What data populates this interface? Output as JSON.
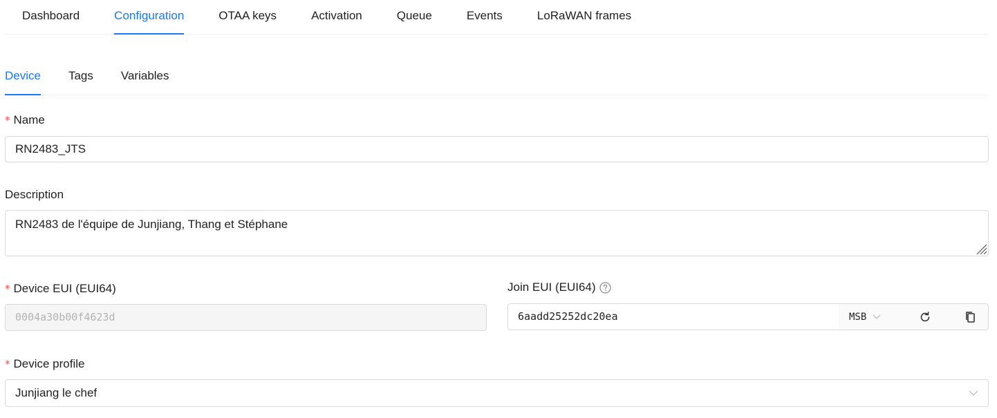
{
  "top_tabs": [
    "Dashboard",
    "Configuration",
    "OTAA keys",
    "Activation",
    "Queue",
    "Events",
    "LoRaWAN frames"
  ],
  "top_tab_active": "Configuration",
  "sub_tabs": [
    "Device",
    "Tags",
    "Variables"
  ],
  "sub_tab_active": "Device",
  "form": {
    "name_label": "Name",
    "name_value": "RN2483_JTS",
    "description_label": "Description",
    "description_value": "RN2483 de l'équipe de Junjiang, Thang et Stéphane",
    "device_eui_label": "Device EUI (EUI64)",
    "device_eui_value": "0004a30b00f4623d",
    "join_eui_label": "Join EUI (EUI64)",
    "join_eui_value": "6aadd25252dc20ea",
    "byte_order": "MSB",
    "device_profile_label": "Device profile",
    "device_profile_value": "Junjiang le chef",
    "required_mark": "*"
  },
  "icons": {
    "help": "question-circle-icon",
    "refresh": "reload-icon",
    "copy": "copy-icon",
    "dropdown": "chevron-down-icon",
    "resize": "resize-handle-icon"
  },
  "colors": {
    "accent": "#1677ff",
    "required": "#ff4d4f",
    "border": "#d9d9d9",
    "disabled_bg": "#f5f5f5"
  }
}
